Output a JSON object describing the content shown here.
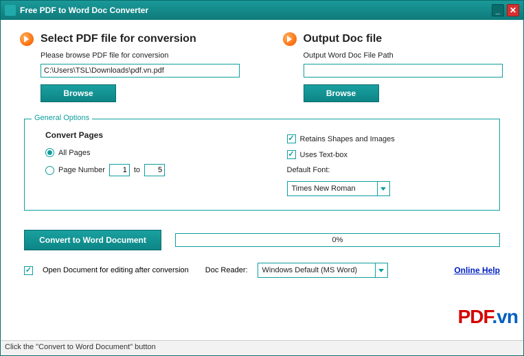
{
  "window": {
    "title": "Free PDF to Word Doc Converter"
  },
  "input": {
    "heading": "Select PDF file for conversion",
    "subtext": "Please browse PDF file for conversion",
    "path": "C:\\Users\\TSL\\Downloads\\pdf.vn.pdf",
    "browse": "Browse"
  },
  "output": {
    "heading": "Output Doc file",
    "subtext": "Output Word Doc File Path",
    "path": "",
    "browse": "Browse"
  },
  "options": {
    "legend": "General Options",
    "convert_pages_label": "Convert Pages",
    "all_pages": "All Pages",
    "page_number": "Page Number",
    "page_from": "1",
    "page_to_label": "to",
    "page_to": "5",
    "retain_shapes": "Retains Shapes and Images",
    "uses_textbox": "Uses Text-box",
    "default_font_label": "Default Font:",
    "default_font": "Times New Roman"
  },
  "actions": {
    "convert": "Convert to Word Document",
    "progress": "0%"
  },
  "footer": {
    "open_after": "Open Document for editing after conversion",
    "doc_reader_label": "Doc Reader:",
    "doc_reader": "Windows Default (MS Word)",
    "online_help": "Online Help"
  },
  "status": "Click the \"Convert to Word Document\" button",
  "watermark": {
    "a": "PDF",
    "b": ".vn"
  }
}
